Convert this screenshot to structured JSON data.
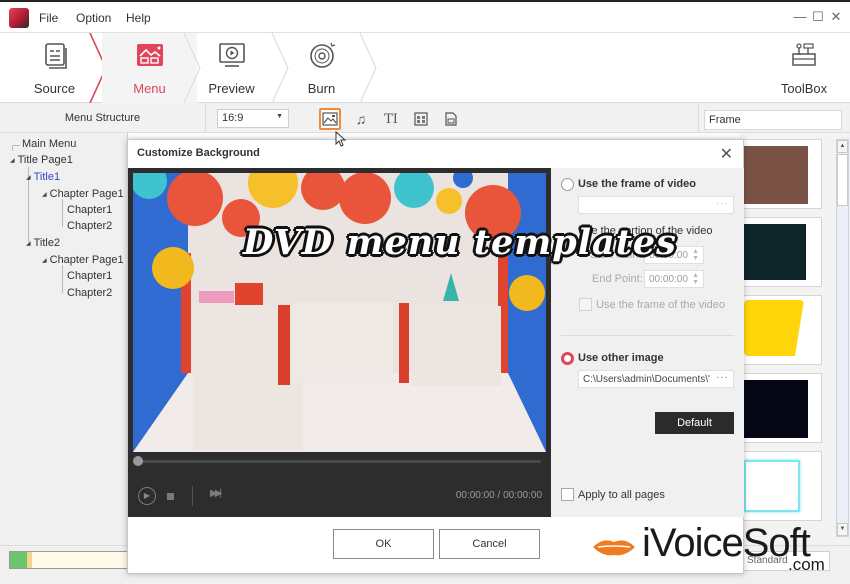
{
  "app": {
    "menu": [
      "File",
      "Option",
      "Help"
    ],
    "window_controls": [
      "minimize",
      "maximize",
      "close"
    ]
  },
  "steps": [
    {
      "label": "Source",
      "icon": "source-icon",
      "active": false
    },
    {
      "label": "Menu",
      "icon": "menu-template-icon",
      "active": true
    },
    {
      "label": "Preview",
      "icon": "preview-icon",
      "active": false
    },
    {
      "label": "Burn",
      "icon": "disc-icon",
      "active": false
    }
  ],
  "toolbox": {
    "label": "ToolBox"
  },
  "toolbar": {
    "menu_structure_label": "Menu Structure",
    "aspect_ratio": "16:9",
    "icons": [
      "background-image-icon",
      "music-icon",
      "text-icon",
      "thumbnail-layout-icon",
      "chapter-icon"
    ],
    "selected_icon": "background-image-icon",
    "frame_field": "Frame"
  },
  "tree": [
    {
      "label": "Main Menu",
      "level": 0,
      "expander": false
    },
    {
      "label": "Title Page1",
      "level": 0,
      "expander": true
    },
    {
      "label": "Title1",
      "level": 1,
      "expander": true,
      "selected": true
    },
    {
      "label": "Chapter Page1",
      "level": 2,
      "expander": true
    },
    {
      "label": "Chapter1",
      "level": 3,
      "expander": false
    },
    {
      "label": "Chapter2",
      "level": 3,
      "expander": false
    },
    {
      "label": "Title2",
      "level": 1,
      "expander": true
    },
    {
      "label": "Chapter Page1",
      "level": 2,
      "expander": true
    },
    {
      "label": "Chapter1",
      "level": 3,
      "expander": false
    },
    {
      "label": "Chapter2",
      "level": 3,
      "expander": false
    }
  ],
  "frames": [
    {
      "name": "brown-frame",
      "color": "#7a5346"
    },
    {
      "name": "dark-teal-frame",
      "color": "#0d2529"
    },
    {
      "name": "yellow-frame",
      "color": "#ffd60a"
    },
    {
      "name": "black-frame",
      "color": "#050714"
    },
    {
      "name": "cyan-outline-frame",
      "color": "#7ee6ee"
    }
  ],
  "standard_field": "Standard",
  "progress": {
    "used_fraction": 0.14,
    "warn_fraction": 0.05
  },
  "dialog": {
    "title": "Customize Background",
    "player": {
      "time": "00:00:00 / 00:00:00",
      "position": 0
    },
    "options": {
      "use_frame_label": "Use the frame of video",
      "use_frame_selected": false,
      "frame_path": "",
      "portion_label": "Use the portion of the video",
      "start_point_label": "Start Point:",
      "start_point": "00:00:00",
      "end_point_label": "End Point:",
      "end_point": "00:00:00",
      "use_frame_of_the_video_label": "Use the frame of the video",
      "use_other_image_label": "Use other image",
      "use_other_image_selected": true,
      "image_path": "C:\\Users\\admin\\Documents\\'",
      "default_button": "Default",
      "apply_all_label": "Apply to all pages",
      "apply_all_checked": false
    },
    "ok_button": "OK",
    "cancel_button": "Cancel"
  },
  "watermark": {
    "title": "DVD menu templates",
    "brand": "iVoiceSoft",
    "brand_suffix": ".com"
  },
  "colors": {
    "accent": "#d9485b",
    "selected_tool_border": "#f08a3c",
    "radio_on": "#e0455c",
    "tree_selected": "#3a43c9",
    "dark_button": "#2b2b2b"
  }
}
